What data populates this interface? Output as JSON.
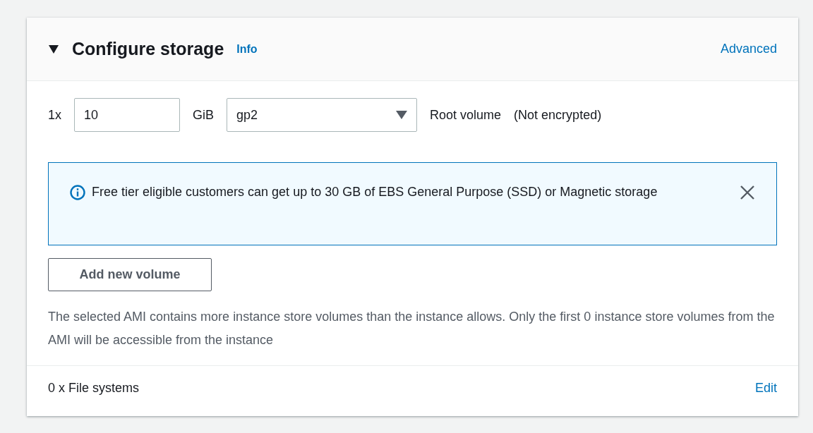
{
  "section": {
    "title": "Configure storage",
    "expanded": true,
    "info_link": "Info",
    "action_link": "Advanced"
  },
  "volume": {
    "count": "1x",
    "size": "10",
    "unit": "GiB",
    "type": "gp2",
    "label": "Root volume",
    "encryption": "(Not encrypted)"
  },
  "alert": {
    "text": "Free tier eligible customers can get up to 30 GB of EBS General Purpose (SSD) or Magnetic storage",
    "dismissible": true
  },
  "add_button": "Add new volume",
  "note": "The selected AMI contains more instance store volumes than the instance allows. Only the first 0 instance store volumes from the AMI will be accessible from the instance",
  "footer": {
    "label": "0 x File systems",
    "link": "Edit"
  }
}
